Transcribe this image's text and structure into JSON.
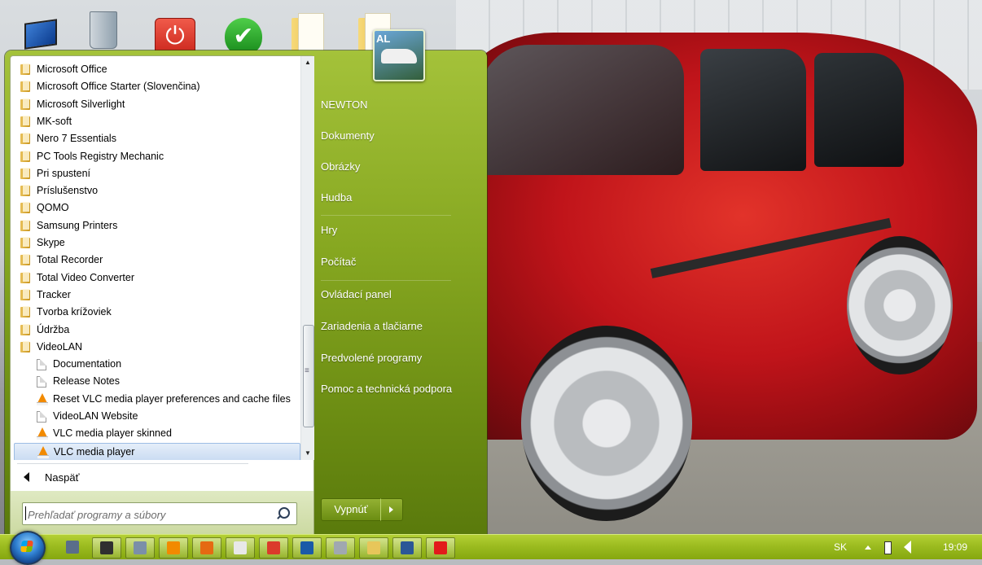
{
  "desktop": {
    "pinned_image_badge": "AL"
  },
  "start_menu": {
    "programs": [
      {
        "label": "Microsoft Office",
        "icon": "folder",
        "level": 1
      },
      {
        "label": "Microsoft Office Starter (Slovenčina)",
        "icon": "folder",
        "level": 1
      },
      {
        "label": "Microsoft Silverlight",
        "icon": "folder",
        "level": 1
      },
      {
        "label": "MK-soft",
        "icon": "folder",
        "level": 1
      },
      {
        "label": "Nero 7 Essentials",
        "icon": "folder",
        "level": 1
      },
      {
        "label": "PC Tools Registry Mechanic",
        "icon": "folder",
        "level": 1
      },
      {
        "label": "Pri spustení",
        "icon": "folder",
        "level": 1
      },
      {
        "label": "Príslušenstvo",
        "icon": "folder",
        "level": 1
      },
      {
        "label": "QOMO",
        "icon": "folder",
        "level": 1
      },
      {
        "label": "Samsung Printers",
        "icon": "folder",
        "level": 1
      },
      {
        "label": "Skype",
        "icon": "folder",
        "level": 1
      },
      {
        "label": "Total Recorder",
        "icon": "folder",
        "level": 1
      },
      {
        "label": "Total Video Converter",
        "icon": "folder",
        "level": 1
      },
      {
        "label": "Tracker",
        "icon": "folder",
        "level": 1
      },
      {
        "label": "Tvorba krížoviek",
        "icon": "folder",
        "level": 1
      },
      {
        "label": "Údržba",
        "icon": "folder",
        "level": 1
      },
      {
        "label": "VideoLAN",
        "icon": "folder",
        "level": 1
      },
      {
        "label": "Documentation",
        "icon": "document",
        "level": 2
      },
      {
        "label": "Release Notes",
        "icon": "document",
        "level": 2
      },
      {
        "label": "Reset VLC media player preferences and cache files",
        "icon": "vlc-cone",
        "level": 2
      },
      {
        "label": "VideoLAN Website",
        "icon": "document",
        "level": 2
      },
      {
        "label": "VLC media player skinned",
        "icon": "vlc-cone",
        "level": 2
      },
      {
        "label": "VLC media player",
        "icon": "vlc-cone",
        "level": 2,
        "selected": true
      }
    ],
    "back_label": "Naspäť",
    "search_placeholder": "Prehľadať programy a súbory",
    "right_items": [
      {
        "label": "NEWTON"
      },
      {
        "label": "Dokumenty"
      },
      {
        "label": "Obrázky"
      },
      {
        "label": "Hudba"
      },
      {
        "label": "Hry"
      },
      {
        "label": "Počítač"
      },
      {
        "label": "Ovládací panel"
      },
      {
        "label": "Zariadenia a tlačiarne"
      },
      {
        "label": "Predvolené programy"
      },
      {
        "label": "Pomoc a technická podpora"
      }
    ],
    "shutdown_label": "Vypnúť"
  },
  "taskbar": {
    "pinned": [
      {
        "icon": "tools-icon",
        "color": "#5a6e8a"
      },
      {
        "icon": "pen-icon",
        "color": "#303030"
      },
      {
        "icon": "calculator-icon",
        "color": "#7b8fa8"
      },
      {
        "icon": "vlc-icon",
        "color": "#f28a00"
      },
      {
        "icon": "firefox-icon",
        "color": "#e56a12"
      },
      {
        "icon": "pdf-icon",
        "color": "#e8e8e8"
      },
      {
        "icon": "chrome-icon",
        "color": "#db3b2b"
      },
      {
        "icon": "edit-icon",
        "color": "#1a5aa8"
      },
      {
        "icon": "cleaner-icon",
        "color": "#a0a8b0"
      },
      {
        "icon": "explorer-icon",
        "color": "#e7c65a"
      },
      {
        "icon": "word-icon",
        "color": "#2b5797"
      },
      {
        "icon": "red-app-icon",
        "color": "#e21b1b"
      }
    ],
    "language": "SK",
    "clock": "19:09"
  }
}
